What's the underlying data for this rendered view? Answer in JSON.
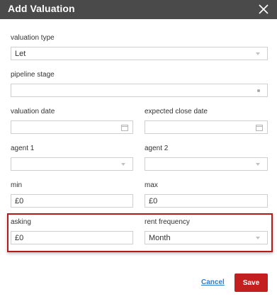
{
  "dialog": {
    "title": "Add Valuation",
    "close_icon": "close-icon"
  },
  "fields": {
    "valuation_type": {
      "label": "valuation type",
      "value": "Let"
    },
    "pipeline_stage": {
      "label": "pipeline stage",
      "value": ""
    },
    "valuation_date": {
      "label": "valuation date",
      "value": ""
    },
    "expected_close_date": {
      "label": "expected close date",
      "value": ""
    },
    "agent_1": {
      "label": "agent 1",
      "value": ""
    },
    "agent_2": {
      "label": "agent 2",
      "value": ""
    },
    "min": {
      "label": "min",
      "value": "£0"
    },
    "max": {
      "label": "max",
      "value": "£0"
    },
    "asking": {
      "label": "asking",
      "value": "£0"
    },
    "rent_frequency": {
      "label": "rent frequency",
      "value": "Month"
    }
  },
  "actions": {
    "cancel_label": "Cancel",
    "save_label": "Save"
  },
  "colors": {
    "header": "#4a4a4a",
    "save_button": "#c41f1f",
    "link": "#2f7dd1",
    "highlight_border": "#b01c1c"
  }
}
